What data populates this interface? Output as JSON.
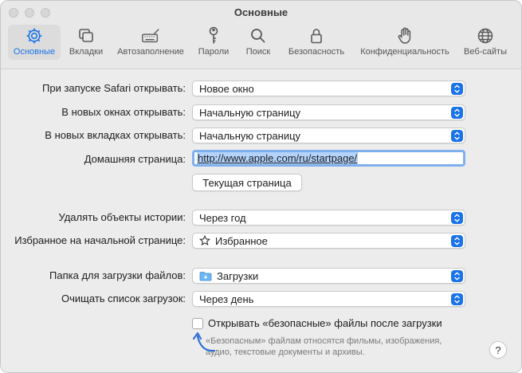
{
  "window": {
    "title": "Основные"
  },
  "toolbar": {
    "tabs": [
      {
        "label": "Основные",
        "icon": "gear-icon",
        "active": true
      },
      {
        "label": "Вкладки",
        "icon": "tabs-icon"
      },
      {
        "label": "Автозаполнение",
        "icon": "keyboard-pen-icon"
      },
      {
        "label": "Пароли",
        "icon": "key-icon"
      },
      {
        "label": "Поиск",
        "icon": "magnifier-icon"
      },
      {
        "label": "Безопасность",
        "icon": "lock-icon"
      },
      {
        "label": "Конфиденциальность",
        "icon": "hand-icon"
      },
      {
        "label": "Веб-сайты",
        "icon": "globe-icon"
      }
    ]
  },
  "settings": {
    "open_with": {
      "label": "При запуске Safari открывать:",
      "value": "Новое окно"
    },
    "new_windows": {
      "label": "В новых окнах открывать:",
      "value": "Начальную страницу"
    },
    "new_tabs": {
      "label": "В новых вкладках открывать:",
      "value": "Начальную страницу"
    },
    "homepage": {
      "label": "Домашняя страница:",
      "value": "http://www.apple.com/ru/startpage/"
    },
    "current_page_button": "Текущая страница",
    "remove_history": {
      "label": "Удалять объекты истории:",
      "value": "Через год"
    },
    "favorites": {
      "label": "Избранное на начальной странице:",
      "value": "Избранное"
    },
    "download_folder": {
      "label": "Папка для загрузки файлов:",
      "value": "Загрузки"
    },
    "clear_downloads": {
      "label": "Очищать список загрузок:",
      "value": "Через день"
    },
    "open_safe_files": {
      "label": "Открывать «безопасные» файлы после загрузки",
      "checked": false
    },
    "hint_line1": "«Безопасным» файлам относятся фильмы, изображения,",
    "hint_line2": "аудио, текстовые документы и архивы.",
    "help": "?"
  },
  "colors": {
    "accent": "#1a73e8",
    "annotation_arrow": "#2f6fd6"
  }
}
